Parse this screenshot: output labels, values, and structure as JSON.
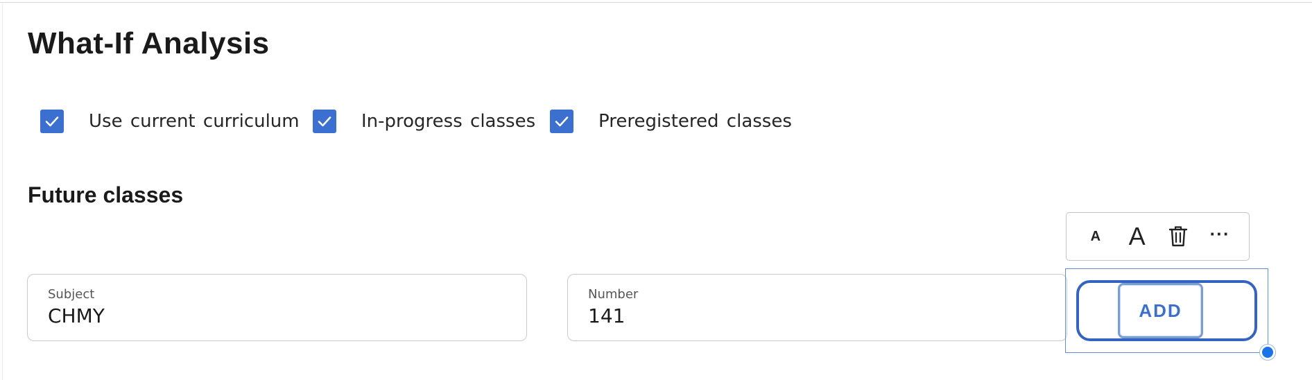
{
  "page": {
    "title": "What-If Analysis"
  },
  "filters": [
    {
      "label": "Use current curriculum",
      "checked": true,
      "icon": "check-icon"
    },
    {
      "label": "In-progress classes",
      "checked": true,
      "icon": "check-icon"
    },
    {
      "label": "Preregistered classes",
      "checked": true,
      "icon": "check-icon"
    }
  ],
  "future_classes": {
    "heading": "Future classes",
    "subject": {
      "label": "Subject",
      "value": "CHMY"
    },
    "number": {
      "label": "Number",
      "value": "141"
    },
    "add_label": "ADD"
  },
  "toolbar": {
    "decrease_font_label": "A",
    "increase_font_label": "A",
    "delete_icon": "trash-icon",
    "more_label": "···"
  },
  "colors": {
    "accent": "#3b6fd0",
    "button_border": "#3563c0",
    "selection_outline": "#5b8fdc",
    "handle": "#1a73e8",
    "text": "#1a1a1a",
    "field_border": "#c9c9c9"
  }
}
